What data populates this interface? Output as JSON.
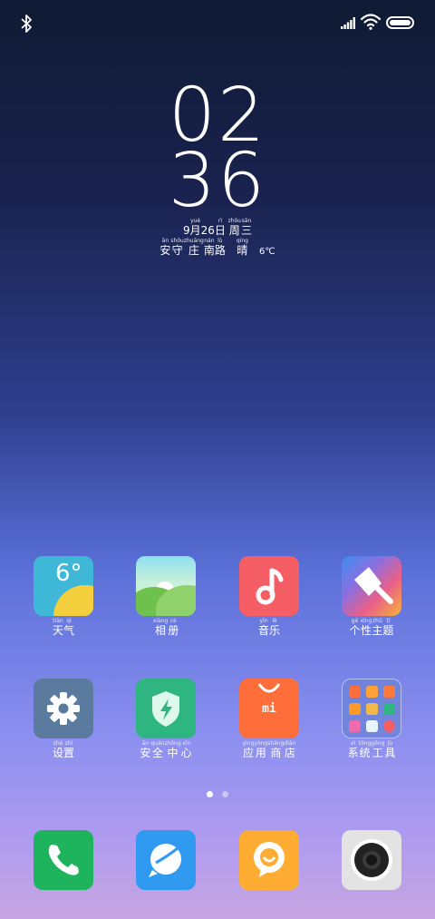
{
  "status_bar": {
    "icons": [
      "bluetooth-icon",
      "signal-icon",
      "wifi-icon",
      "battery-icon"
    ]
  },
  "clock": {
    "hour": "02",
    "minute": "36"
  },
  "date": {
    "month_num": "9",
    "month_char": "月",
    "month_py": "yuè",
    "day_num": "26",
    "day_char": "日",
    "day_py": "rì",
    "weekday_1": "周",
    "weekday_1_py": "zhōu",
    "weekday_2": "三",
    "weekday_2_py": "sān"
  },
  "location_weather": {
    "chars": [
      {
        "c": "安",
        "p": "ān"
      },
      {
        "c": "守",
        "p": "shǒu"
      },
      {
        "c": "庄",
        "p": "zhuāng"
      },
      {
        "c": "南",
        "p": "nán"
      },
      {
        "c": "路",
        "p": "lù"
      }
    ],
    "weather_char": "晴",
    "weather_py": "qíng",
    "temperature": "6℃"
  },
  "apps_row1": [
    {
      "icon": "weather-icon",
      "label": [
        {
          "c": "天",
          "p": "tiān"
        },
        {
          "c": "气",
          "p": "qì"
        }
      ],
      "icon_text": "6°"
    },
    {
      "icon": "gallery-icon",
      "label": [
        {
          "c": "相",
          "p": "xiàng"
        },
        {
          "c": "册",
          "p": "cè"
        }
      ]
    },
    {
      "icon": "music-icon",
      "label": [
        {
          "c": "音",
          "p": "yīn"
        },
        {
          "c": "乐",
          "p": "lè"
        }
      ]
    },
    {
      "icon": "themes-icon",
      "label": [
        {
          "c": "个",
          "p": "gè"
        },
        {
          "c": "性",
          "p": "xìng"
        },
        {
          "c": "主",
          "p": "zhǔ"
        },
        {
          "c": "题",
          "p": "tí"
        }
      ]
    }
  ],
  "apps_row2": [
    {
      "icon": "settings-icon",
      "label": [
        {
          "c": "设",
          "p": "shè"
        },
        {
          "c": "置",
          "p": "zhì"
        }
      ]
    },
    {
      "icon": "security-icon",
      "label": [
        {
          "c": "安",
          "p": "ān"
        },
        {
          "c": "全",
          "p": "quán"
        },
        {
          "c": "中",
          "p": "zhōng"
        },
        {
          "c": "心",
          "p": "xīn"
        }
      ]
    },
    {
      "icon": "app-store-icon",
      "label": [
        {
          "c": "应",
          "p": "yìng"
        },
        {
          "c": "用",
          "p": "yòng"
        },
        {
          "c": "商",
          "p": "shāng"
        },
        {
          "c": "店",
          "p": "diàn"
        }
      ],
      "icon_text": "mi"
    },
    {
      "icon": "system-tools-folder-icon",
      "label": [
        {
          "c": "系",
          "p": "xì"
        },
        {
          "c": "统",
          "p": "tǒng"
        },
        {
          "c": "工",
          "p": "gōng"
        },
        {
          "c": "具",
          "p": "jù"
        }
      ]
    }
  ],
  "page_indicator": {
    "pages": 2,
    "active": 1
  },
  "dock": [
    "phone-icon",
    "messages-icon",
    "chat-icon",
    "camera-icon"
  ],
  "colors": {
    "weather": "#3fb8d8",
    "gallery": "#8fd26b",
    "music": "#f45e64",
    "settings": "#5a7a9e",
    "security": "#2fb57f",
    "store": "#ff6d3a",
    "folder": "#6e84d8",
    "phone": "#1db45d",
    "messages": "#2f9af0",
    "chat": "#ffac33",
    "camera": "#e3e3e3"
  }
}
